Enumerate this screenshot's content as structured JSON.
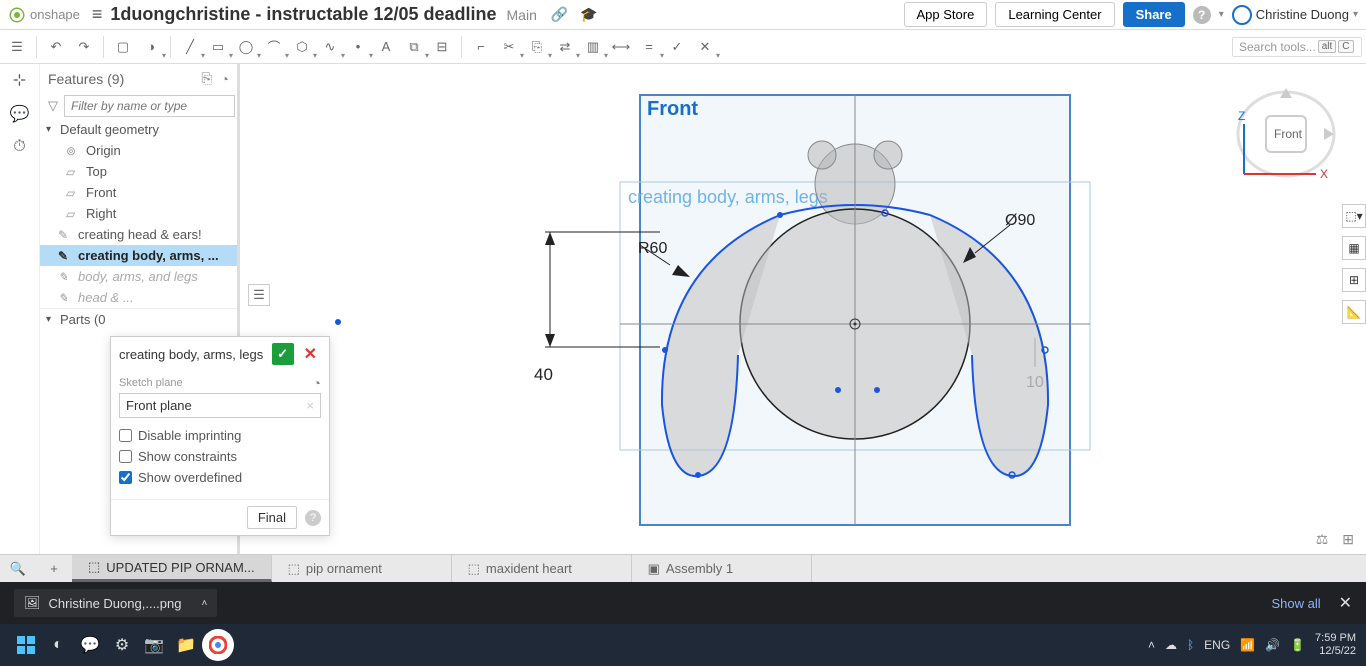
{
  "header": {
    "brand": "onshape",
    "doc_title": "1duongchristine - instructable 12/05 deadline",
    "branch": "Main",
    "app_store": "App Store",
    "learning_center": "Learning Center",
    "share": "Share",
    "user_name": "Christine Duong"
  },
  "toolbar": {
    "search_placeholder": "Search tools...",
    "kbd1": "alt",
    "kbd2": "C"
  },
  "features": {
    "title": "Features (9)",
    "filter_placeholder": "Filter by name or type",
    "default_geometry": "Default geometry",
    "origin": "Origin",
    "top": "Top",
    "front": "Front",
    "right": "Right",
    "f1": "creating head & ears!",
    "f2": "creating body, arms, ...",
    "f3": "body, arms, and legs",
    "f4": "head & ...",
    "parts": "Parts (0"
  },
  "dialog": {
    "title": "creating body, arms, legs",
    "plane_label": "Sketch plane",
    "plane_value": "Front plane",
    "chk1": "Disable imprinting",
    "chk2": "Show constraints",
    "chk3": "Show overdefined",
    "final": "Final"
  },
  "canvas": {
    "front_label": "Front",
    "sketch_label": "creating body, arms, legs",
    "r60": "R60",
    "d90": "Ø90",
    "dim40": "40",
    "dim10": "10",
    "view_front": "Front",
    "axis_z": "Z",
    "axis_x": "X"
  },
  "tabs": {
    "t1": "UPDATED PIP ORNAM...",
    "t2": "pip ornament",
    "t3": "maxident heart",
    "t4": "Assembly 1"
  },
  "browser": {
    "file": "Christine Duong,....png",
    "show_all": "Show all"
  },
  "tray": {
    "lang": "ENG",
    "time": "7:59 PM",
    "date": "12/5/22"
  }
}
